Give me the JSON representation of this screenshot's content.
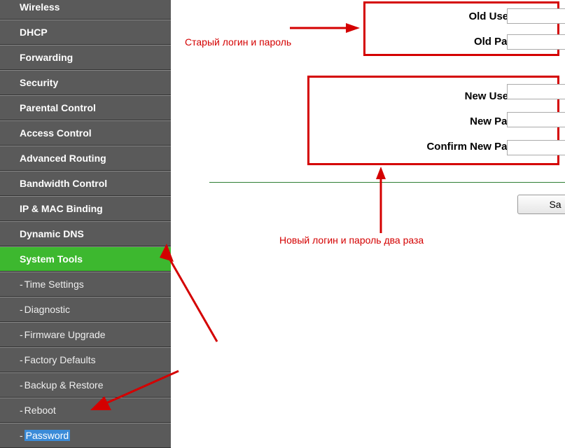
{
  "sidebar": {
    "items": [
      {
        "label": "Wireless"
      },
      {
        "label": "DHCP"
      },
      {
        "label": "Forwarding"
      },
      {
        "label": "Security"
      },
      {
        "label": "Parental Control"
      },
      {
        "label": "Access Control"
      },
      {
        "label": "Advanced Routing"
      },
      {
        "label": "Bandwidth Control"
      },
      {
        "label": "IP & MAC Binding"
      },
      {
        "label": "Dynamic DNS"
      },
      {
        "label": "System Tools"
      }
    ],
    "subitems": [
      {
        "label": "Time Settings"
      },
      {
        "label": "Diagnostic"
      },
      {
        "label": "Firmware Upgrade"
      },
      {
        "label": "Factory Defaults"
      },
      {
        "label": "Backup & Restore"
      },
      {
        "label": "Reboot"
      },
      {
        "label": "Password"
      }
    ]
  },
  "form": {
    "old_username_label": "Old User Name:",
    "old_password_label": "Old Password:",
    "new_username_label": "New User Name:",
    "new_password_label": "New Password:",
    "confirm_password_label": "Confirm New Password:",
    "save_label": "Sa"
  },
  "annotations": {
    "old_text": "Старый логин и пароль",
    "new_text": "Новый логин и пароль два раза"
  }
}
